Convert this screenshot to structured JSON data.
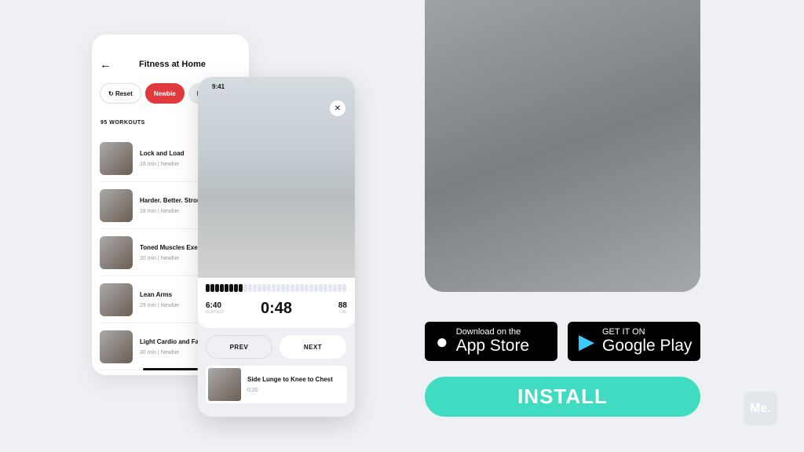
{
  "list_screen": {
    "title": "Fitness at Home",
    "chips": [
      "Reset",
      "Newbie",
      "Medium"
    ],
    "count": "95 WORKOUTS",
    "workouts": [
      {
        "name": "Lock and Load",
        "meta": "16 min | Newbie"
      },
      {
        "name": "Harder. Better. Stronger",
        "meta": "18 min | Newbie"
      },
      {
        "name": "Toned Muscles Exercises",
        "meta": "20 min | Newbie"
      },
      {
        "name": "Lean Arms",
        "meta": "29 min | Newbie"
      },
      {
        "name": "Light Cardio and Fat Burn",
        "meta": "30 min | Newbie"
      }
    ]
  },
  "workout_screen": {
    "time": "9:41",
    "progress_filled": 8,
    "progress_total": 30,
    "elapsed": "6:40",
    "elapsed_label": "ELAPSED",
    "timer": "0:48",
    "cal": "88",
    "cal_label": "CAL",
    "prev": "PREV",
    "next": "NEXT",
    "next_exercise": {
      "name": "Side Lunge to Knee to Chest",
      "duration": "0:20"
    }
  },
  "app_store": {
    "line1": "Download on the",
    "line2": "App Store"
  },
  "google_play": {
    "line1": "GET IT ON",
    "line2": "Google Play"
  },
  "install": "INSTALL",
  "logo": "Me.",
  "colors": {
    "accent": "#e2393d",
    "install": "#3fdcc1"
  }
}
